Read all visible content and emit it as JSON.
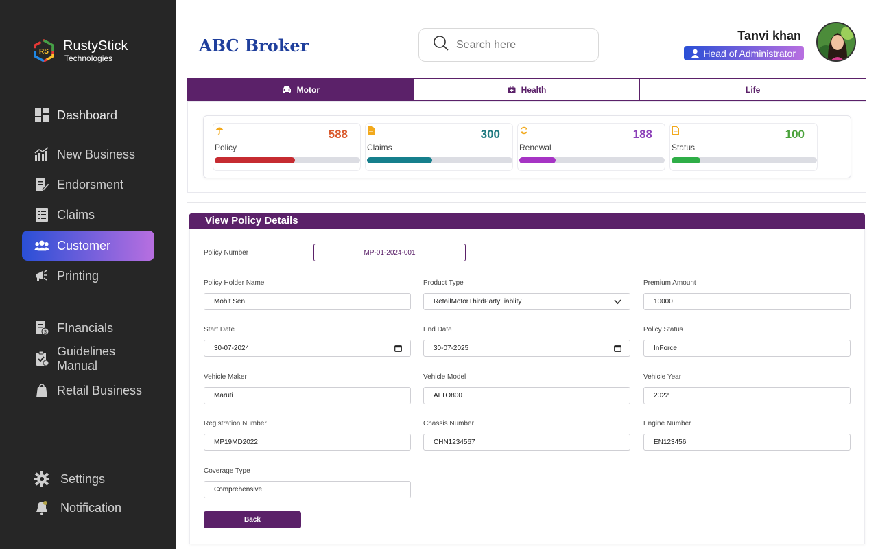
{
  "app": {
    "logo_name": "RustyStick",
    "logo_sub": "Technologies",
    "brand": "ABC Broker"
  },
  "sidebar": {
    "items": [
      {
        "label": "Dashboard",
        "icon": "dashboard-icon"
      },
      {
        "label": "New Business",
        "icon": "chart-icon"
      },
      {
        "label": "Endorsment",
        "icon": "edit-document-icon"
      },
      {
        "label": "Claims",
        "icon": "clipboard-list-icon"
      },
      {
        "label": "Customer",
        "icon": "users-icon",
        "active": true
      },
      {
        "label": "Printing",
        "icon": "megaphone-icon"
      },
      {
        "label": "FInancials",
        "icon": "financial-document-icon"
      },
      {
        "label": "Guidelines Manual",
        "icon": "clipboard-check-icon"
      },
      {
        "label": "Retail Business",
        "icon": "shopping-bag-icon"
      },
      {
        "label": "Settings",
        "icon": "gear-icon"
      },
      {
        "label": "Notification",
        "icon": "bell-icon"
      }
    ]
  },
  "header": {
    "search_placeholder": "Search here",
    "user_name": "Tanvi khan",
    "role": "Head of Administrator"
  },
  "tabs": [
    {
      "label": "Motor",
      "icon": "car-icon",
      "active": true
    },
    {
      "label": "Health",
      "icon": "medical-kit-icon"
    },
    {
      "label": "Life",
      "icon": ""
    }
  ],
  "stats": [
    {
      "label": "Policy",
      "value": "588",
      "color": "#d9582b",
      "bar_color": "#c62b31",
      "progress": 0.55,
      "icon": "umbrella-icon"
    },
    {
      "label": "Claims",
      "value": "300",
      "color": "#1f7a80",
      "bar_color": "#167f8c",
      "progress": 0.45,
      "icon": "document-icon"
    },
    {
      "label": "Renewal",
      "value": "188",
      "color": "#8b3fb8",
      "bar_color": "#a634c4",
      "progress": 0.25,
      "icon": "refresh-icon"
    },
    {
      "label": "Status",
      "value": "100",
      "color": "#4aa23a",
      "bar_color": "#2fae47",
      "progress": 0.2,
      "icon": "file-icon"
    }
  ],
  "form": {
    "section_title": "View Policy Details",
    "policy_number_label": "Policy Number",
    "policy_number": "MP-01-2024-001",
    "fields": [
      {
        "label": "Policy Holder Name",
        "value": "Mohit Sen"
      },
      {
        "label": "Product Type",
        "value": "RetailMotorThirdPartyLiablity"
      },
      {
        "label": "Premium Amount",
        "value": "10000"
      },
      {
        "label": "Start Date",
        "value": "30-07-2024"
      },
      {
        "label": "End Date",
        "value": "30-07-2025"
      },
      {
        "label": "Policy Status",
        "value": "InForce"
      },
      {
        "label": "Vehicle Maker",
        "value": "Maruti"
      },
      {
        "label": "Vehicle Model",
        "value": "ALTO800"
      },
      {
        "label": "Vehicle Year",
        "value": "2022"
      },
      {
        "label": "Registration Number",
        "value": "MP19MD2022"
      },
      {
        "label": "Chassis Number",
        "value": "CHN1234567"
      },
      {
        "label": "Engine Number",
        "value": "EN123456"
      },
      {
        "label": "Coverage Type",
        "value": "Comprehensive"
      }
    ],
    "back_label": "Back"
  },
  "colors": {
    "primary": "#5b2169",
    "sidebar_bg": "#262626",
    "brand": "#1f3f9c"
  }
}
